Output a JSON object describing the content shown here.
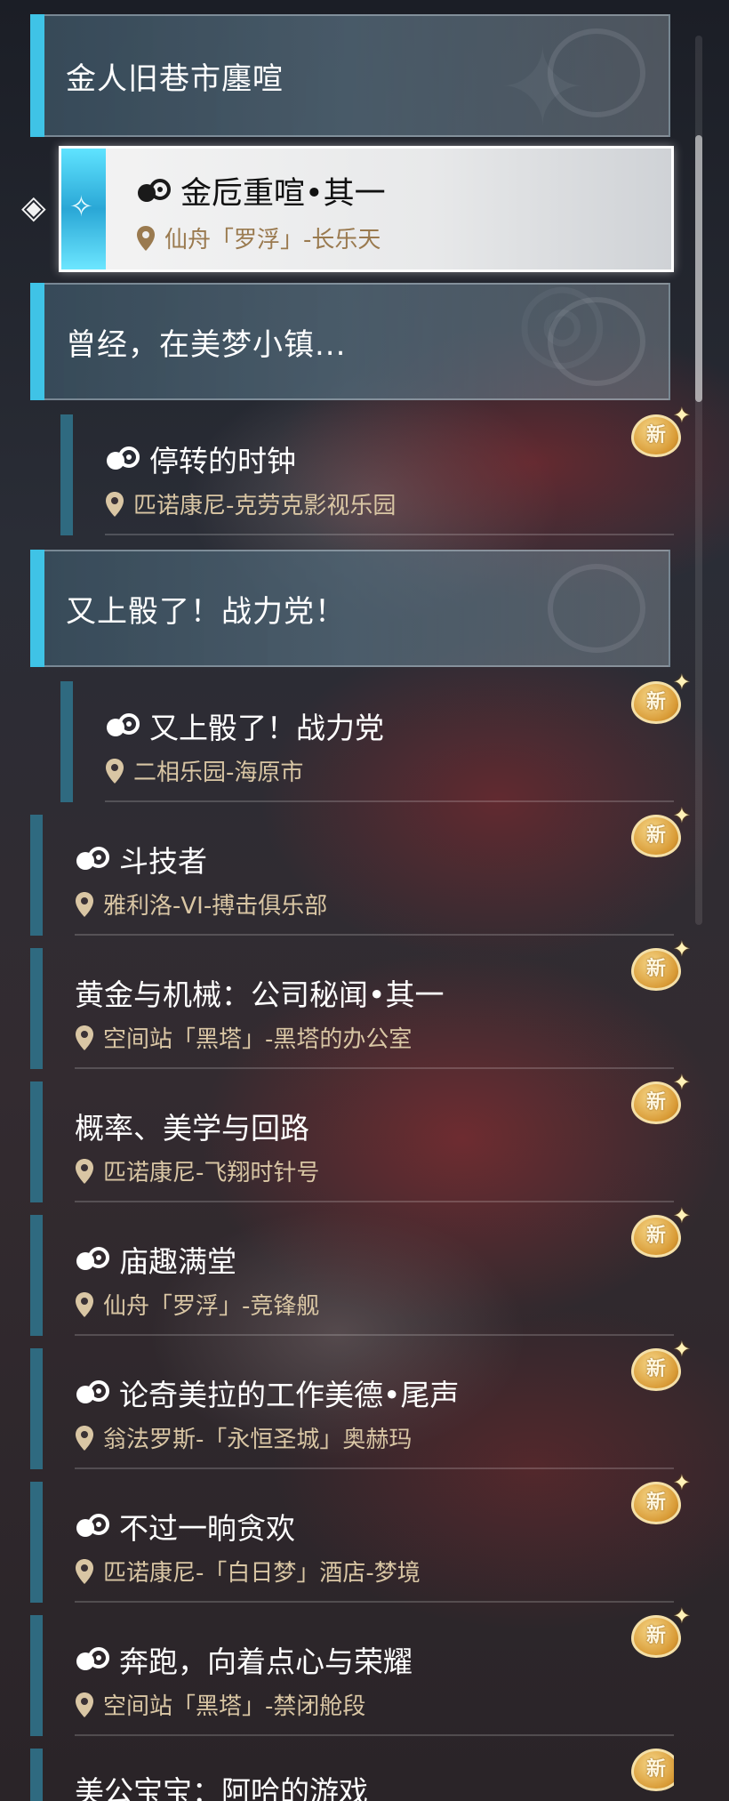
{
  "groups": [
    {
      "title": "金人旧巷市廛喧",
      "entries": [
        {
          "title": "金卮重喧•其一",
          "location": "仙舟「罗浮」-长乐天",
          "selected": true,
          "new": false
        }
      ]
    },
    {
      "title": "曾经，在美梦小镇...",
      "entries": [
        {
          "title": "停转的时钟",
          "location": "匹诺康尼-克劳克影视乐园",
          "new": true
        }
      ]
    },
    {
      "title": "又上骰了！战力党！",
      "entries": [
        {
          "title": "又上骰了！战力党",
          "location": "二相乐园-海原市",
          "new": true
        }
      ]
    }
  ],
  "entries": [
    {
      "title": "斗技者",
      "location": "雅利洛-VI-搏击俱乐部",
      "quest_icon": true,
      "new": true
    },
    {
      "title": "黄金与机械：公司秘闻•其一",
      "location": "空间站「黑塔」-黑塔的办公室",
      "quest_icon": false,
      "new": true
    },
    {
      "title": "概率、美学与回路",
      "location": "匹诺康尼-飞翔时针号",
      "quest_icon": false,
      "new": true
    },
    {
      "title": "庙趣满堂",
      "location": "仙舟「罗浮」-竞锋舰",
      "quest_icon": true,
      "new": true
    },
    {
      "title": "论奇美拉的工作美德•尾声",
      "location": "翁法罗斯-「永恒圣城」奥赫玛",
      "quest_icon": true,
      "new": true
    },
    {
      "title": "不过一晌贪欢",
      "location": "匹诺康尼-「白日梦」酒店-梦境",
      "quest_icon": true,
      "new": true
    },
    {
      "title": "奔跑，向着点心与荣耀",
      "location": "空间站「黑塔」-禁闭舱段",
      "quest_icon": true,
      "new": true
    },
    {
      "title": "美公宝宝：阿哈的游戏",
      "location": "",
      "quest_icon": false,
      "new": true
    }
  ],
  "badge_label": "新",
  "icons": {
    "quest": "quest-mark-icon",
    "location": "location-pin-icon",
    "selector": "selector-diamond-icon"
  },
  "colors": {
    "accent": "#3fc3e6",
    "location_text": "#d9c6a4",
    "badge": "#e0a640"
  }
}
